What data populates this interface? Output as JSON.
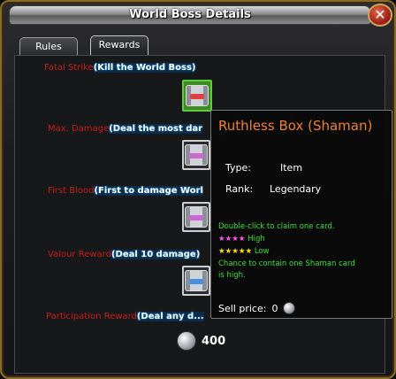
{
  "window": {
    "title": "World Boss Details",
    "close_label": "✕"
  },
  "tabs": [
    {
      "label": "Rules"
    },
    {
      "label": "Rewards"
    }
  ],
  "rewards": [
    {
      "desc": "Fatal Strike",
      "cond": "(Kill the World Boss)"
    },
    {
      "desc": "Max. Damage",
      "cond": "(Deal the most dar"
    },
    {
      "desc": "First Blood",
      "cond": "(First to damage Worl"
    },
    {
      "desc": "Valour Reward",
      "cond": "(Deal 10 damage)"
    },
    {
      "desc": "Participation Reward",
      "cond": "(Deal any d..."
    }
  ],
  "total_reward": {
    "value": "400"
  },
  "tooltip": {
    "title": "Ruthless Box (Shaman)",
    "type_label": "Type:",
    "type_value": "Item",
    "rank_label": "Rank:",
    "rank_value": "Legendary",
    "desc1": "Double-click to claim one card.",
    "high_stars": "★★★★",
    "high_label": "High",
    "low_stars": "★★★★★",
    "low_label": "Low",
    "desc2": "Chance to contain one Shaman card",
    "desc3": "is high.",
    "sell_label": "Sell price:",
    "sell_value": "0"
  },
  "colors": {
    "tooltip_title": "#f07f30",
    "green_text": "#35e035",
    "selected_slot": "#5fcc3b"
  }
}
